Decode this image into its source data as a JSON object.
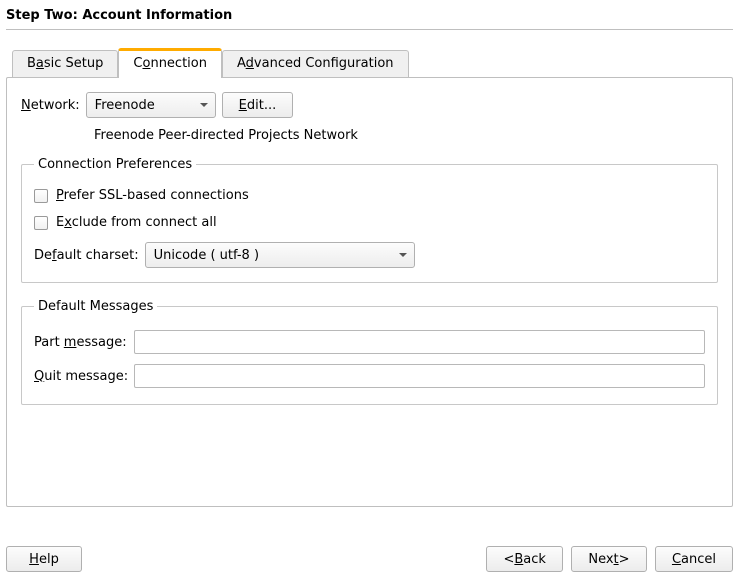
{
  "header": {
    "title": "Step Two: Account Information"
  },
  "tabs": {
    "basic": {
      "pre": "B",
      "u": "a",
      "post": "sic Setup"
    },
    "conn": {
      "pre": "C",
      "u": "o",
      "post": "nnection"
    },
    "adv": {
      "pre": "A",
      "u": "d",
      "post": "vanced Configuration"
    }
  },
  "network": {
    "label_pre": "",
    "label_u": "N",
    "label_post": "etwork:",
    "value": "Freenode",
    "edit_pre": "",
    "edit_u": "E",
    "edit_post": "dit...",
    "desc": "Freenode Peer-directed Projects Network"
  },
  "conn_prefs": {
    "legend": "Connection Preferences",
    "ssl_pre": "",
    "ssl_u": "P",
    "ssl_post": "refer SSL-based connections",
    "excl_pre": "E",
    "excl_u": "x",
    "excl_post": "clude from connect all",
    "charset_label_pre": "De",
    "charset_label_u": "f",
    "charset_label_post": "ault charset:",
    "charset_value": "Unicode ( utf-8 )"
  },
  "default_msgs": {
    "legend": "Default Messages",
    "part_pre": "Part ",
    "part_u": "m",
    "part_post": "essage:",
    "quit_pre": "",
    "quit_u": "Q",
    "quit_post": "uit message:",
    "part_value": "",
    "quit_value": ""
  },
  "footer": {
    "help_pre": "",
    "help_u": "H",
    "help_post": "elp",
    "back_pre": "< ",
    "back_u": "B",
    "back_post": "ack",
    "next_pre": "Nex",
    "next_u": "t",
    "next_post": " >",
    "cancel_pre": "",
    "cancel_u": "C",
    "cancel_post": "ancel"
  }
}
